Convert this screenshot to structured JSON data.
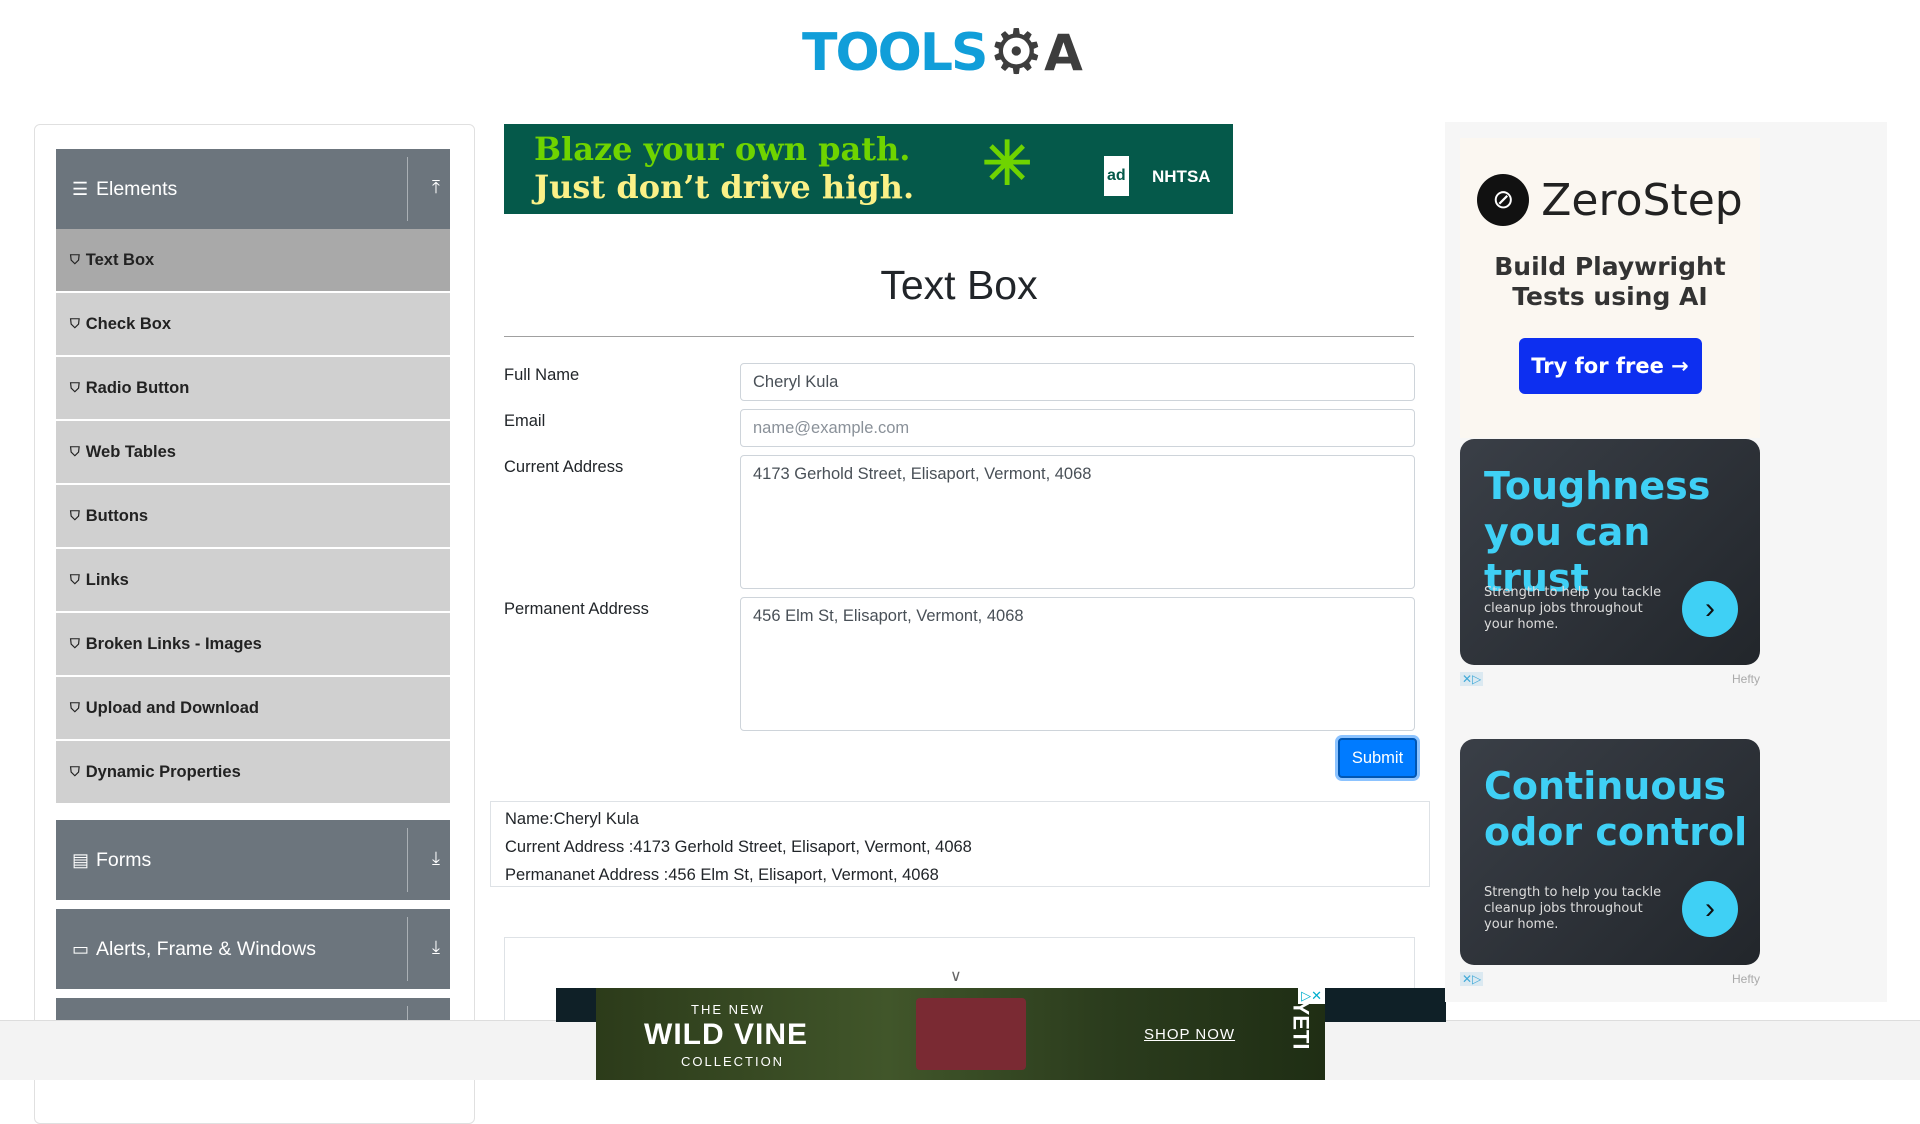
{
  "logo": {
    "text_tools": "TOOLS",
    "text_qa": "A",
    "alt": "TOOLSQA"
  },
  "sidebar": {
    "groups": [
      {
        "label": "Elements",
        "icon": "hamburger-icon",
        "state": "expanded"
      },
      {
        "label": "Forms",
        "icon": "document-icon",
        "state": "collapsed"
      },
      {
        "label": "Alerts, Frame & Windows",
        "icon": "window-icon",
        "state": "collapsed"
      }
    ],
    "items": [
      {
        "label": "Text Box",
        "active": true
      },
      {
        "label": "Check Box"
      },
      {
        "label": "Radio Button"
      },
      {
        "label": "Web Tables"
      },
      {
        "label": "Buttons"
      },
      {
        "label": "Links"
      },
      {
        "label": "Broken Links - Images"
      },
      {
        "label": "Upload and Download"
      },
      {
        "label": "Dynamic Properties"
      }
    ]
  },
  "top_ad": {
    "line1": "Blaze your own path.",
    "line2": "Just don’t drive high.",
    "badge1": "ad",
    "badge2": "NHTSA"
  },
  "main": {
    "title": "Text Box",
    "form": {
      "full_name": {
        "label": "Full Name",
        "value": "Cheryl Kula"
      },
      "email": {
        "label": "Email",
        "value": "",
        "placeholder": "name@example.com"
      },
      "current_address": {
        "label": "Current Address",
        "value": "4173 Gerhold Street, Elisaport, Vermont, 4068"
      },
      "permanent_address": {
        "label": "Permanent Address",
        "value": "456 Elm St, Elisaport, Vermont, 4068"
      },
      "submit_label": "Submit"
    },
    "output": {
      "name": "Name:Cheryl Kula",
      "current": "Current Address :4173 Gerhold Street, Elisaport, Vermont, 4068",
      "permanent": "Permananet Address :456 Elm St, Elisaport, Vermont, 4068"
    }
  },
  "bottom_ad": {
    "the_new": "THE NEW",
    "headline": "WILD VINE",
    "collection": "COLLECTION",
    "cta": "SHOP NOW",
    "brand": "YETI"
  },
  "right_ads": {
    "zerostep": {
      "brand": "ZeroStep",
      "tagline": "Build Playwright Tests using AI",
      "cta": "Try for free →"
    },
    "hefty1": {
      "headline": "Toughness you can trust",
      "body": "Strength to help you tackle cleanup jobs throughout your home.",
      "brand": "Hefty"
    },
    "hefty2": {
      "headline": "Continuous odor control",
      "body": "Strength to help you tackle cleanup jobs throughout your home.",
      "brand": "Hefty"
    }
  },
  "colors": {
    "accent": "#007bff",
    "sidebar_header": "#6c757d",
    "sidebar_item": "#d0d0d0",
    "sidebar_active": "#a9a9a9",
    "logo_blue": "#119ed9"
  }
}
